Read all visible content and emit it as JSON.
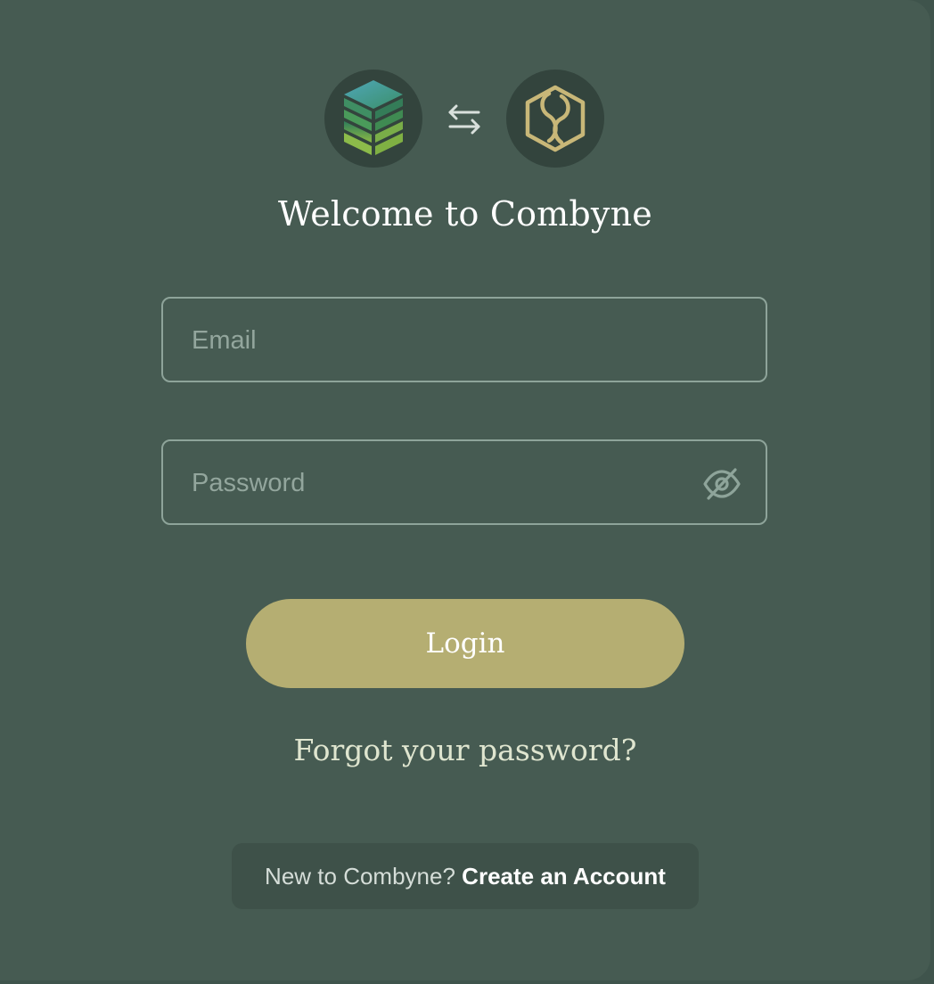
{
  "header": {
    "left_logo": "combyne-stack-logo-icon",
    "sync_icon": "swap-arrows-icon",
    "right_logo": "partner-hexagon-logo-icon",
    "title": "Welcome to Combyne"
  },
  "form": {
    "email": {
      "placeholder": "Email",
      "value": ""
    },
    "password": {
      "placeholder": "Password",
      "value": "",
      "toggle_icon": "eye-off-icon"
    },
    "login_label": "Login",
    "forgot_label": "Forgot your password?"
  },
  "signup": {
    "prefix": "New to Combyne?",
    "link": "Create an Account"
  },
  "colors": {
    "background": "#465b52",
    "primary_button": "#b5ae72",
    "field_border": "#8ea49a",
    "logo_circle": "#33443d",
    "accent_gold": "#c8b778"
  }
}
